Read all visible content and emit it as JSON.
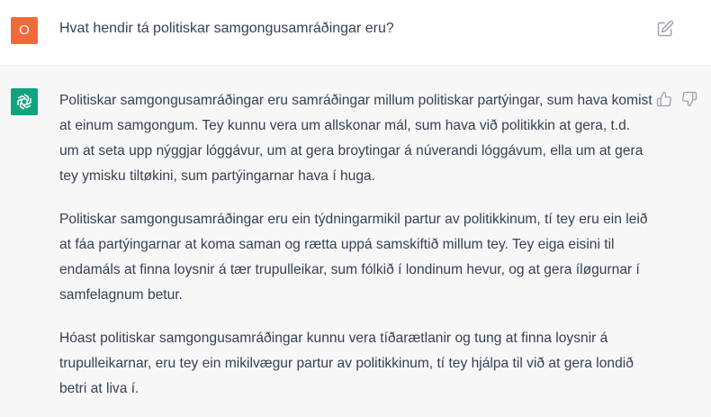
{
  "user_message": {
    "avatar_letter": "O",
    "text": "Hvat hendir tá politiskar samgongusamráðingar eru?"
  },
  "assistant_message": {
    "paragraphs": [
      "Politiskar samgongusamráðingar eru samráðingar millum politiskar partýingar, sum hava komist at einum samgongum. Tey kunnu vera um allskonar mál, sum hava við politikkin at gera, t.d. um at seta upp nýggjar lóggávur, um at gera broytingar á núverandi lóggávum, ella um at gera tey ymisku tiltøkini, sum partýingarnar hava í huga.",
      "Politiskar samgongusamráðingar eru ein týdningarmikil partur av politikkinum, tí tey eru ein leið at fáa partýingarnar at koma saman og rætta uppá samskiftið millum tey. Tey eiga eisini til endamáls at finna loysnir á tær trupulleikar, sum fólkið í londinum hevur, og at gera íløgurnar í samfelagnum betur.",
      "Hóast politiskar samgongusamráðingar kunnu vera tíðarætlanir og tung at finna loysnir á trupulleikarnar, eru tey ein mikilvægur partur av politikkinum, tí tey hjálpa til við at gera londið betri at liva í."
    ]
  },
  "icons": {
    "edit": "edit-icon",
    "thumb_up": "thumb-up-icon",
    "thumb_down": "thumb-down-icon",
    "assistant_logo": "openai-logo-icon"
  },
  "colors": {
    "user_avatar_bg": "#f26a3a",
    "assistant_avatar_bg": "#10a37f",
    "assistant_row_bg": "#f7f7f8"
  }
}
